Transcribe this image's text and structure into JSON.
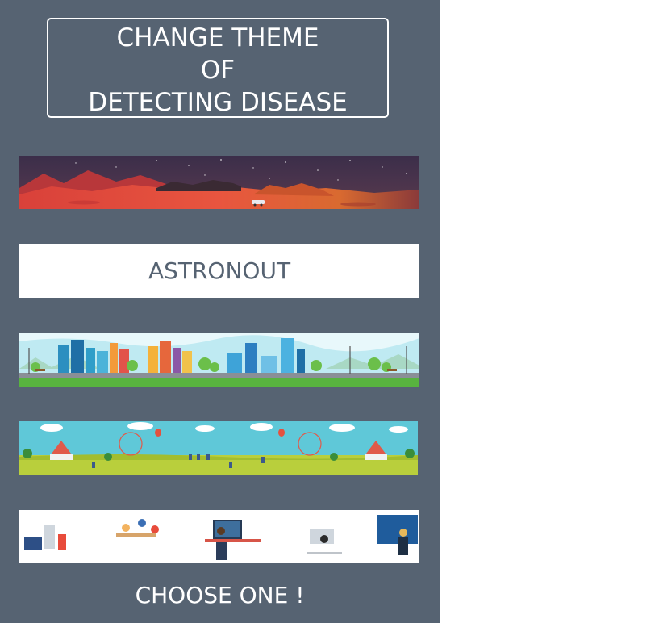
{
  "title": {
    "line1": "CHANGE THEME",
    "line2": "OF",
    "line3": "DETECTING DISEASE"
  },
  "selected_theme_label": "ASTRONOUT",
  "footer_text": "CHOOSE ONE !",
  "themes": [
    {
      "id": "astronaut",
      "icon": "mars-landscape-banner"
    },
    {
      "id": "city",
      "icon": "city-skyline-banner"
    },
    {
      "id": "fair",
      "icon": "amusement-park-banner"
    },
    {
      "id": "office",
      "icon": "office-workers-banner"
    }
  ],
  "colors": {
    "panel": "#566372",
    "text_light": "#ffffff",
    "button_bg": "#ffffff",
    "button_text": "#566372"
  }
}
